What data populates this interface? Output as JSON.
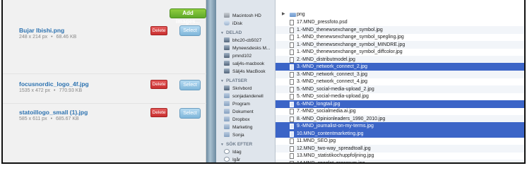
{
  "media": {
    "add_button": "Add images...",
    "items": [
      {
        "name": "Bujar Ibishi.png",
        "dimensions": "248 x 214 px",
        "size": "68.46 KB",
        "delete": "Delete",
        "select": "Select"
      },
      {
        "name": "focusnordic_logo_4f.jpg",
        "dimensions": "1535 x 472 px",
        "size": "770.93 KB",
        "delete": "Delete",
        "select": "Select"
      },
      {
        "name": "statoillogo_small (1).jpg",
        "dimensions": "585 x 611 px",
        "size": "685.67 KB",
        "delete": "Delete",
        "select": "Select"
      }
    ],
    "separator": "•"
  },
  "sidebar": {
    "devices": [
      "Macintosh HD",
      "iDisk"
    ],
    "shared_label": "DELAD",
    "shared": [
      "bhc20-cb5027",
      "Mynewsdesks M...",
      "pmnd102",
      "salj4s-macbook",
      "Sälj4s MacBook"
    ],
    "places_label": "PLATSER",
    "places": [
      "Skrivbord",
      "sonjadandenell",
      "Program",
      "Dokument",
      "Dropbox",
      "Marketing",
      "Sonja"
    ],
    "search_label": "SÖK EFTER",
    "search": [
      "Idag",
      "Igår"
    ]
  },
  "files": {
    "folder": "png",
    "rows": [
      {
        "name": "17.MND_pressfoto.psd",
        "selected": false
      },
      {
        "name": "1.-MND_thenewsexchange_symbol.jpg",
        "selected": false
      },
      {
        "name": "1.-MND_thenewsexchange_symbol_spegling.jpg",
        "selected": false
      },
      {
        "name": "1.-MND_thenewsexchange_symbol_MINDRE.jpg",
        "selected": false
      },
      {
        "name": "1.-MND_thenewsexchange_symbol_diffcolor.jpg",
        "selected": false
      },
      {
        "name": "2.-MND_distributmodel.jpg",
        "selected": false
      },
      {
        "name": "3.-MND_network_connect_2.jpg",
        "selected": true
      },
      {
        "name": "3.-MND_network_connect_3.jpg",
        "selected": false
      },
      {
        "name": "3.-MND_network_connect_4.jpg",
        "selected": false
      },
      {
        "name": "5.-MND_social-media-upload_2.jpg",
        "selected": false
      },
      {
        "name": "5.-MND_social-media-upload.jpg",
        "selected": false
      },
      {
        "name": "6.-MND_longtail.jpg",
        "selected": true
      },
      {
        "name": "7.-MND_socialmedia.ai.jpg",
        "selected": false
      },
      {
        "name": "8.-MND_Opinionleaders_1990_2010.jpg",
        "selected": false
      },
      {
        "name": "9.-MND_journalist-on-my-terms.jpg",
        "selected": true
      },
      {
        "name": "10.MND_contentmarketing.jpg",
        "selected": true
      },
      {
        "name": "11.MND_SEO.jpg",
        "selected": false
      },
      {
        "name": "12.MND_two-way_spreadtoall.jpg",
        "selected": false
      },
      {
        "name": "13.MND_statistikochuppfoljning.jpg",
        "selected": false
      },
      {
        "name": "14.MND_speglat_pressrum.jpg",
        "selected": false
      }
    ]
  },
  "colors": {
    "selection": "#3c65c7",
    "link": "#2c72b0",
    "add_button": "#6cb52f",
    "delete": "#d23d3d",
    "select": "#8fc0e0"
  }
}
